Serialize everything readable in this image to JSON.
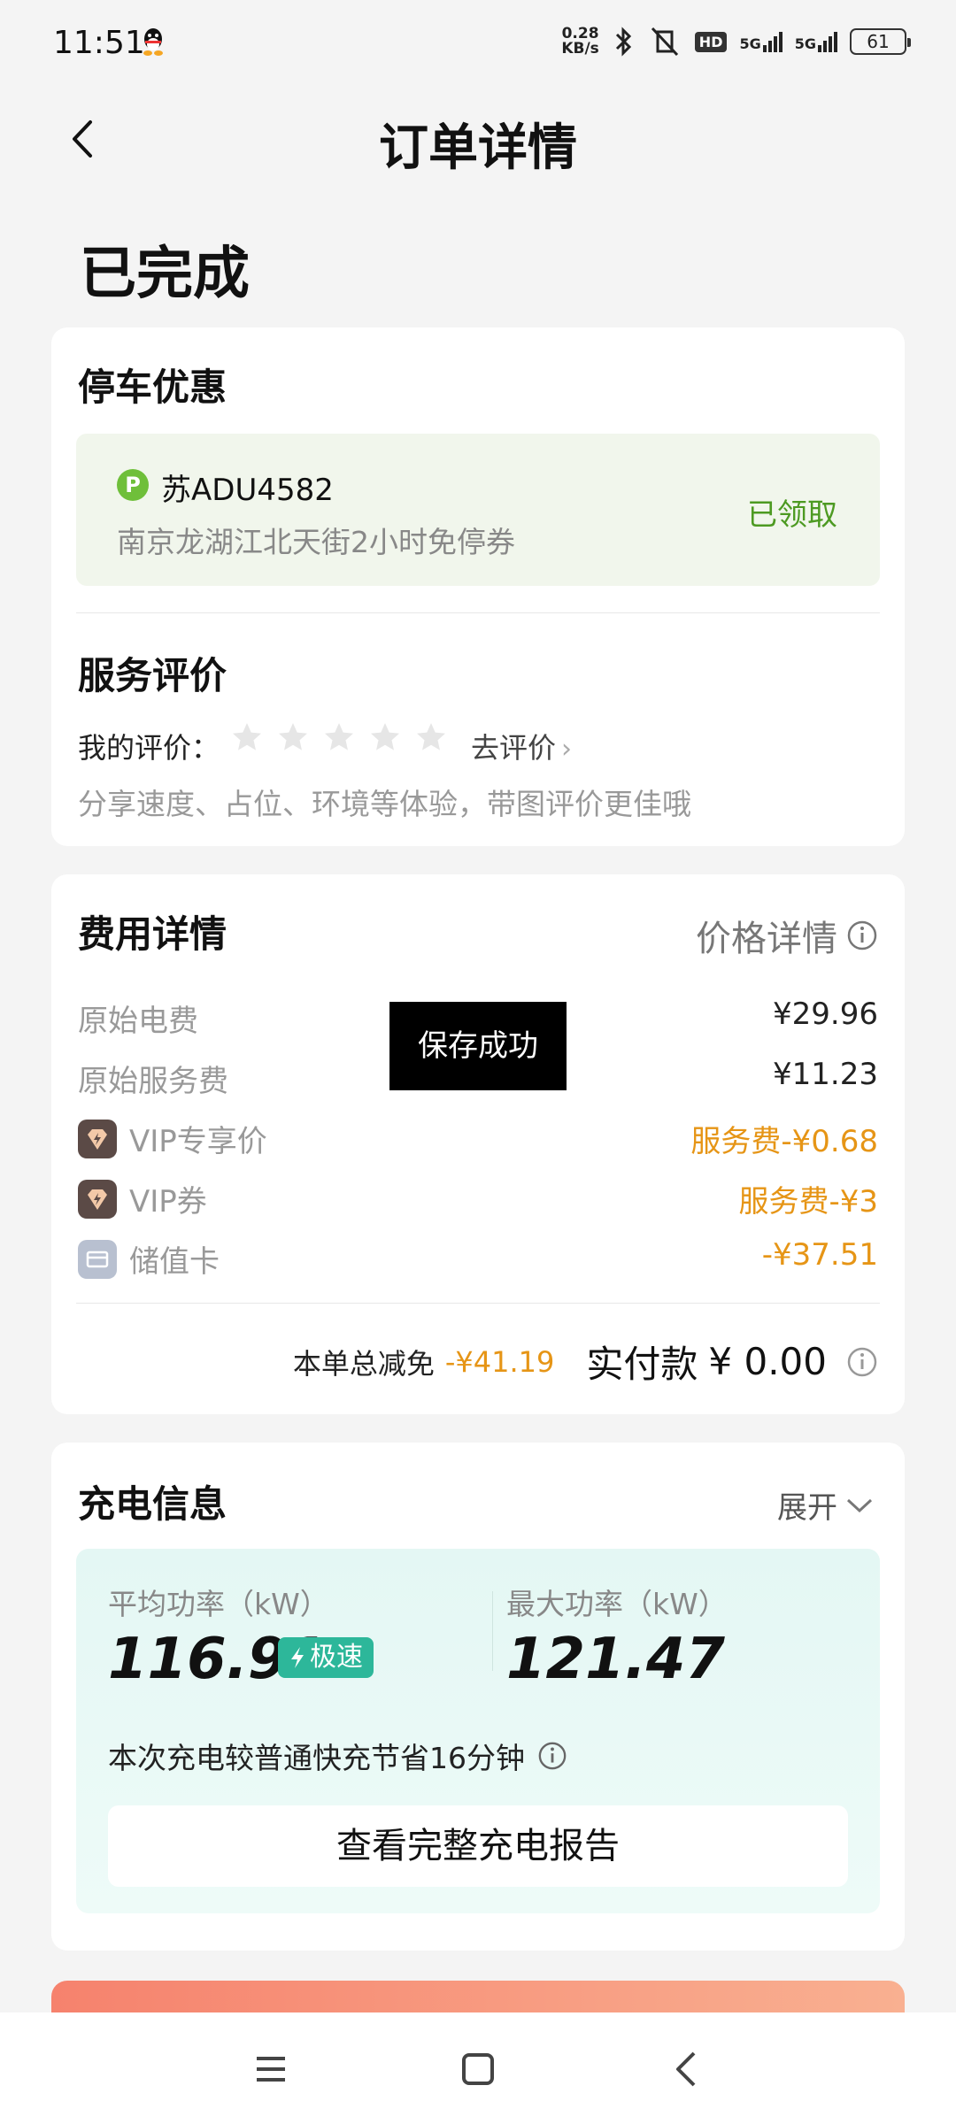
{
  "status_bar": {
    "time": "11:51",
    "net_speed_value": "0.28",
    "net_speed_unit": "KB/s",
    "hd_label": "HD",
    "signal1": "5G",
    "signal2": "5G",
    "battery": "61"
  },
  "header": {
    "title": "订单详情"
  },
  "order": {
    "status": "已完成"
  },
  "parking": {
    "title": "停车优惠",
    "badge": "P",
    "plate": "苏ADU4582",
    "coupon": "南京龙湖江北天街2小时免停券",
    "coupon_status": "已领取"
  },
  "rating": {
    "title": "服务评价",
    "my_rating_label": "我的评价：",
    "stars": 5,
    "filled_stars": 0,
    "action": "去评价",
    "hint": "分享速度、占位、环境等体验，带图评价更佳哦"
  },
  "fees": {
    "title": "费用详情",
    "price_detail": "价格详情",
    "rows": [
      {
        "label": "原始电费",
        "value": "¥29.96"
      },
      {
        "label": "原始服务费",
        "value": "¥11.23"
      },
      {
        "label": "VIP专享价",
        "value": "服务费-¥0.68"
      },
      {
        "label": "VIP券",
        "value": "服务费-¥3"
      },
      {
        "label": "储值卡",
        "value": "-¥37.51"
      }
    ],
    "discount_label": "本单总减免",
    "discount_value": "-¥41.19",
    "paid_label": "实付款",
    "paid_value": "¥ 0.00"
  },
  "toast": {
    "text": "保存成功"
  },
  "charging": {
    "title": "充电信息",
    "expand": "展开",
    "avg_label": "平均功率（kW）",
    "avg_value": "116.91",
    "speed_badge": "极速",
    "max_label": "最大功率（kW）",
    "max_value": "121.47",
    "save_text": "本次充电较普通快充节省16分钟",
    "report_button": "查看完整充电报告"
  },
  "colors": {
    "accent_green": "#4d9a22",
    "accent_orange": "#e69516",
    "teal": "#2db79a"
  }
}
